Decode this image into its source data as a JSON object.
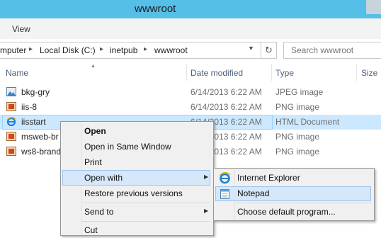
{
  "window": {
    "title": "wwwroot"
  },
  "ribbon": {
    "view_tab": "View"
  },
  "address": {
    "crumbs": [
      "mputer",
      "Local Disk (C:)",
      "inetpub",
      "wwwroot"
    ]
  },
  "search": {
    "placeholder": "Search wwwroot"
  },
  "columns": {
    "name": "Name",
    "date": "Date modified",
    "type": "Type",
    "size": "Size"
  },
  "files": [
    {
      "name": "bkg-gry",
      "date": "6/14/2013 6:22 AM",
      "type": "JPEG image",
      "icon": "jpeg-image-icon"
    },
    {
      "name": "iis-8",
      "date": "6/14/2013 6:22 AM",
      "type": "PNG image",
      "icon": "png-image-icon"
    },
    {
      "name": "iisstart",
      "date": "6/14/2013 6:22 AM",
      "type": "HTML Document",
      "icon": "ie-document-icon"
    },
    {
      "name": "msweb-br",
      "date": "6/14/2013 6:22 AM",
      "type": "PNG image",
      "icon": "png-image-icon"
    },
    {
      "name": "ws8-brand",
      "date": "6/14/2013 6:22 AM",
      "type": "PNG image",
      "icon": "png-image-icon"
    }
  ],
  "context_menu": {
    "open": "Open",
    "open_same_window": "Open in Same Window",
    "print": "Print",
    "open_with": "Open with",
    "restore": "Restore previous versions",
    "send_to": "Send to",
    "cut": "Cut"
  },
  "submenu": {
    "ie": "Internet Explorer",
    "notepad": "Notepad",
    "default": "Choose default program..."
  },
  "colors": {
    "titlebar": "#55bfe8",
    "selection": "#cce8ff",
    "menu_highlight": "#d5e7f9"
  }
}
